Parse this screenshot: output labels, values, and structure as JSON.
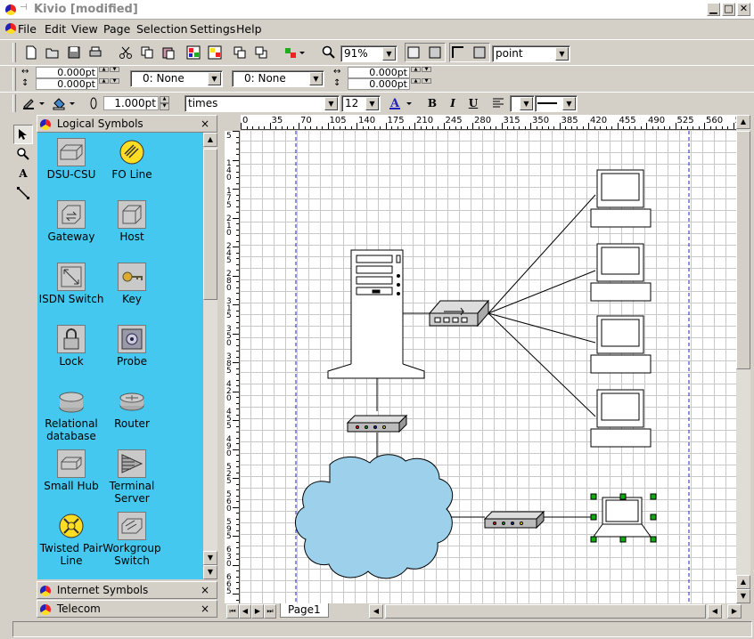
{
  "window": {
    "title": "Kivio [modified]"
  },
  "menu": [
    "File",
    "Edit",
    "View",
    "Page",
    "Selection",
    "Settings",
    "Help"
  ],
  "toolbar": {
    "zoom": "91%",
    "unit": "point"
  },
  "geometry_bar": {
    "x": "0.000pt",
    "y": "0.000pt",
    "w": "0.000pt",
    "h": "0.000pt",
    "arrow_start": "0: None",
    "arrow_end": "0: None"
  },
  "format_bar": {
    "line_width": "1.000pt",
    "font": "times",
    "font_size": "12",
    "bold": "B",
    "italic": "I",
    "underline": "U"
  },
  "ruler_labels": [
    "0",
    "35",
    "70",
    "105",
    "140",
    "175",
    "210",
    "245",
    "280",
    "315",
    "350",
    "385",
    "420",
    "455",
    "490",
    "525",
    "560",
    "5"
  ],
  "ruler_labels_v": [
    "5",
    "140",
    "175",
    "210",
    "245",
    "280",
    "315",
    "350",
    "385",
    "420",
    "455",
    "490",
    "525",
    "560",
    "595",
    "630",
    "665"
  ],
  "stencils": {
    "logical": {
      "title": "Logical Symbols",
      "items": [
        {
          "label": "DSU-CSU",
          "icon": "dsu-csu-icon"
        },
        {
          "label": "FO Line",
          "icon": "fo-line-icon"
        },
        {
          "label": "Gateway",
          "icon": "gateway-icon"
        },
        {
          "label": "Host",
          "icon": "host-icon"
        },
        {
          "label": "ISDN Switch",
          "icon": "isdn-switch-icon"
        },
        {
          "label": "Key",
          "icon": "key-icon"
        },
        {
          "label": "Lock",
          "icon": "lock-icon"
        },
        {
          "label": "Probe",
          "icon": "probe-icon"
        },
        {
          "label": "Relational database",
          "icon": "database-icon"
        },
        {
          "label": "Router",
          "icon": "router-icon"
        },
        {
          "label": "Small Hub",
          "icon": "small-hub-icon"
        },
        {
          "label": "Terminal Server",
          "icon": "terminal-server-icon"
        },
        {
          "label": "Twisted Pair Line",
          "icon": "twisted-pair-icon"
        },
        {
          "label": "Workgroup Switch",
          "icon": "workgroup-switch-icon"
        }
      ]
    },
    "internet": {
      "title": "Internet Symbols"
    },
    "telecom": {
      "title": "Telecom"
    }
  },
  "page_tabs": [
    "Page1"
  ],
  "tools": [
    "select-tool-icon",
    "zoom-tool-icon",
    "text-tool-icon",
    "connector-tool-icon"
  ]
}
